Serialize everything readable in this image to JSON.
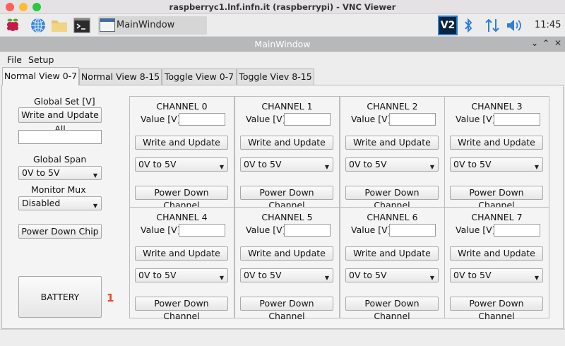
{
  "mac": {
    "title": "raspberryc1.lnf.infn.it (raspberrypi) - VNC Viewer"
  },
  "taskbar": {
    "task_label": "MainWindow",
    "vnc_label": "V2",
    "clock": "11:45"
  },
  "window": {
    "title": "MainWindow"
  },
  "menu": [
    "File",
    "Setup"
  ],
  "tabs": [
    "Normal View 0-7",
    "Normal View 8-15",
    "Toggle View 0-7",
    "Toggle Viev 8-15"
  ],
  "left": {
    "global_set_label": "Global Set [V]",
    "write_all_label": "Write and Update All",
    "global_value": "",
    "global_span_label": "Global Span",
    "global_span_value": "0V to 5V",
    "monitor_mux_label": "Monitor Mux",
    "monitor_mux_value": "Disabled",
    "power_down_chip_label": "Power Down Chip",
    "battery_label": "BATTERY",
    "battery_value": "1"
  },
  "channels": [
    {
      "title": "CHANNEL 0",
      "value_label": "Value [V]",
      "write_label": "Write and Update",
      "span": "0V to 5V",
      "power_label": "Power Down Channel"
    },
    {
      "title": "CHANNEL 1",
      "value_label": "Value [V]",
      "write_label": "Write and Update",
      "span": "0V to 5V",
      "power_label": "Power Down Channel"
    },
    {
      "title": "CHANNEL 2",
      "value_label": "Value [V]",
      "write_label": "Write and Update",
      "span": "0V to 5V",
      "power_label": "Power Down Channel"
    },
    {
      "title": "CHANNEL 3",
      "value_label": "Value [V]",
      "write_label": "Write and Update",
      "span": "0V to 5V",
      "power_label": "Power Down Channel"
    },
    {
      "title": "CHANNEL 4",
      "value_label": "Value [V]",
      "write_label": "Write and Update",
      "span": "0V to 5V",
      "power_label": "Power Down Channel"
    },
    {
      "title": "CHANNEL 5",
      "value_label": "Value [V]",
      "write_label": "Write and Update",
      "span": "0V to 5V",
      "power_label": "Power Down Channel"
    },
    {
      "title": "CHANNEL 6",
      "value_label": "Value [V]",
      "write_label": "Write and Update",
      "span": "0V to 5V",
      "power_label": "Power Down Channel"
    },
    {
      "title": "CHANNEL 7",
      "value_label": "Value [V]",
      "write_label": "Write and Update",
      "span": "0V to 5V",
      "power_label": "Power Down Channel"
    }
  ],
  "colors": {
    "battery_value": "#e8452c",
    "tray_accent": "#2f7fd3"
  }
}
